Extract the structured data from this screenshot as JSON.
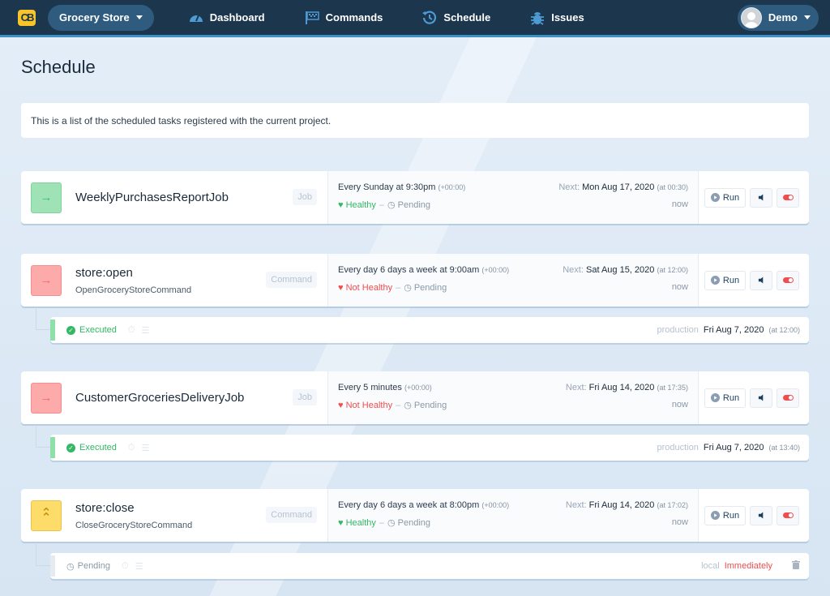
{
  "navbar": {
    "project": "Grocery Store",
    "items": [
      {
        "label": "Dashboard",
        "icon": "gauge-icon"
      },
      {
        "label": "Commands",
        "icon": "flag-icon"
      },
      {
        "label": "Schedule",
        "icon": "history-icon"
      },
      {
        "label": "Issues",
        "icon": "bug-icon"
      }
    ],
    "user": "Demo"
  },
  "page": {
    "title": "Schedule",
    "description": "This is a list of the scheduled tasks registered with the current project."
  },
  "labels": {
    "next": "Next:",
    "run": "Run",
    "pending": "Pending",
    "now": "now",
    "dash": "–"
  },
  "colors": {
    "healthy": "#33b866",
    "unhealthy": "#f04e4e",
    "nav_bg": "#1c364d",
    "accent": "#3c8fc7"
  },
  "tasks": [
    {
      "name": "WeeklyPurchasesReportJob",
      "class": "",
      "type": "Job",
      "icon": "arrow-right-icon",
      "icon_color": "green",
      "frequency": "Every Sunday at 9:30pm",
      "tz": "(+00:00)",
      "health": "Healthy",
      "status": "Pending",
      "next_date": "Mon Aug 17, 2020",
      "next_time": "(at 00:30)",
      "next_rel": "now"
    },
    {
      "name": "store:open",
      "class": "OpenGroceryStoreCommand",
      "type": "Command",
      "icon": "arrow-right-icon",
      "icon_color": "red",
      "frequency": "Every day 6 days a week at 9:00am",
      "tz": "(+00:00)",
      "health": "Not Healthy",
      "status": "Pending",
      "next_date": "Sat Aug 15, 2020",
      "next_time": "(at 12:00)",
      "next_rel": "now",
      "last_run": {
        "status": "Executed",
        "env": "production",
        "date": "Fri Aug 7, 2020",
        "time": "(at 12:00)"
      }
    },
    {
      "name": "CustomerGroceriesDeliveryJob",
      "class": "",
      "type": "Job",
      "icon": "arrow-right-icon",
      "icon_color": "red",
      "frequency": "Every 5 minutes",
      "tz": "(+00:00)",
      "health": "Not Healthy",
      "status": "Pending",
      "next_date": "Fri Aug 14, 2020",
      "next_time": "(at 17:35)",
      "next_rel": "now",
      "last_run": {
        "status": "Executed",
        "env": "production",
        "date": "Fri Aug 7, 2020",
        "time": "(at 13:40)"
      }
    },
    {
      "name": "store:close",
      "class": "CloseGroceryStoreCommand",
      "type": "Command",
      "icon": "chevrons-up-icon",
      "icon_color": "yellow",
      "frequency": "Every day 6 days a week at 8:00pm",
      "tz": "(+00:00)",
      "health": "Healthy",
      "status": "Pending",
      "next_date": "Fri Aug 14, 2020",
      "next_time": "(at 17:02)",
      "next_rel": "now",
      "last_run": {
        "status": "Pending",
        "env": "local",
        "date": "Immediately",
        "time": ""
      }
    }
  ]
}
